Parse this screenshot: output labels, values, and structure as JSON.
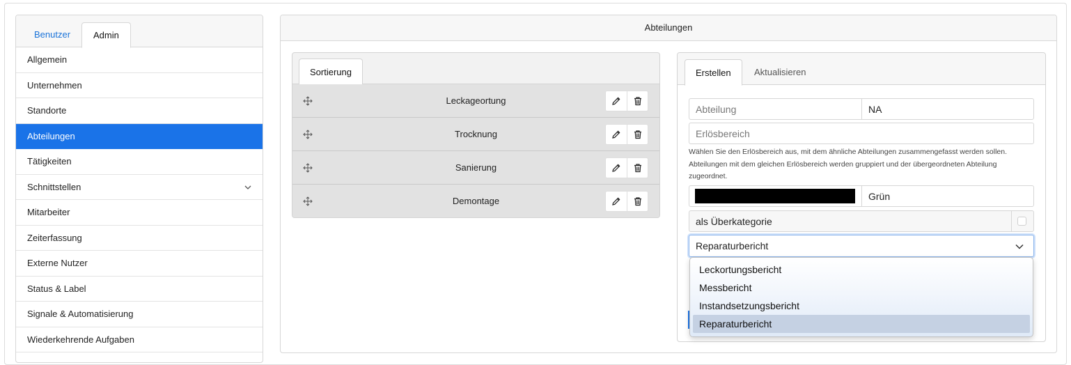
{
  "nav": {
    "tabs": [
      {
        "label": "Benutzer",
        "active": false
      },
      {
        "label": "Admin",
        "active": true
      }
    ],
    "items": [
      {
        "label": "Allgemein"
      },
      {
        "label": "Unternehmen"
      },
      {
        "label": "Standorte"
      },
      {
        "label": "Abteilungen",
        "active": true
      },
      {
        "label": "Tätigkeiten"
      },
      {
        "label": "Schnittstellen",
        "icon": "chevron-down-icon"
      },
      {
        "label": "Mitarbeiter"
      },
      {
        "label": "Zeiterfassung"
      },
      {
        "label": "Externe Nutzer"
      },
      {
        "label": "Status & Label"
      },
      {
        "label": "Signale & Automatisierung"
      },
      {
        "label": "Wiederkehrende Aufgaben"
      }
    ]
  },
  "main": {
    "title": "Abteilungen",
    "sort": {
      "tab": "Sortierung",
      "rows": [
        {
          "label": "Leckageortung"
        },
        {
          "label": "Trocknung"
        },
        {
          "label": "Sanierung"
        },
        {
          "label": "Demontage"
        }
      ]
    },
    "form": {
      "tabs": [
        {
          "label": "Erstellen",
          "active": true
        },
        {
          "label": "Aktualisieren",
          "active": false
        }
      ],
      "abteilung_label": "Abteilung",
      "abteilung_value": "NA",
      "erloes_placeholder": "Erlösbereich",
      "hint": "Wählen Sie den Erlösbereich aus, mit dem ähnliche Abteilungen zusammengefasst werden sollen. Abteilungen mit dem gleichen Erlösbereich werden gruppiert und der übergeordneten Abteilung zugeordnet.",
      "color_hex": "#000000",
      "color_name": "Grün",
      "ueberkategorie_label": "als Überkategorie",
      "ueberkategorie_checked": false,
      "report_selected": "Reparaturbericht",
      "report_options": [
        "Leckortungsbericht",
        "Messbericht",
        "Instandsetzungsbericht",
        "Reparaturbericht"
      ]
    }
  },
  "colors": {
    "accent": "#1a73e8",
    "link": "#1a73d9",
    "row_bg": "#e2e2e2"
  }
}
